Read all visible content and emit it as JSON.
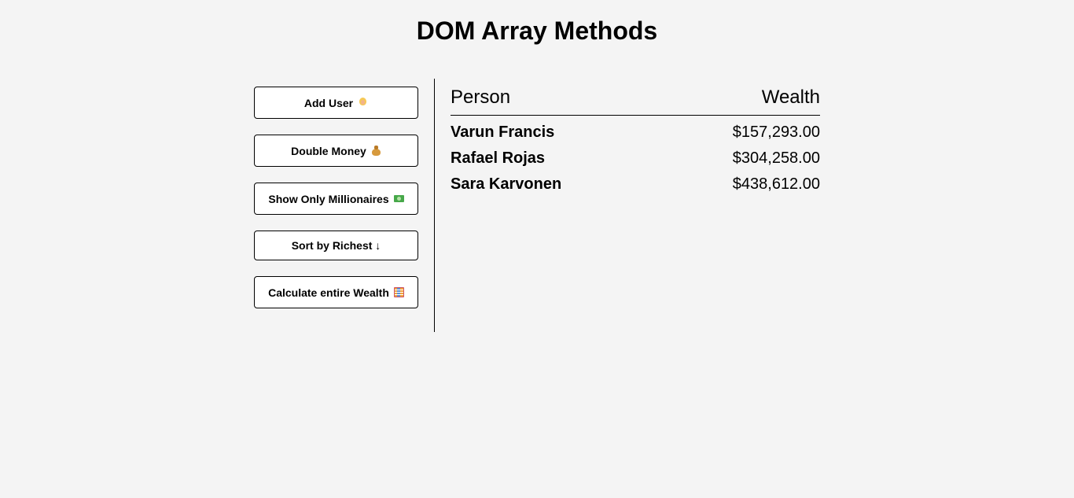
{
  "page": {
    "title": "DOM Array Methods"
  },
  "buttons": [
    {
      "label": "Add User",
      "icon": "person-emoji-icon"
    },
    {
      "label": "Double Money",
      "icon": "money-bag-emoji-icon"
    },
    {
      "label": "Show Only Millionaires",
      "icon": "dollar-bill-emoji-icon"
    },
    {
      "label": "Sort by Richest ↓",
      "icon": ""
    },
    {
      "label": "Calculate entire Wealth",
      "icon": "abacus-emoji-icon"
    }
  ],
  "table": {
    "headers": {
      "person": "Person",
      "wealth": "Wealth"
    },
    "rows": [
      {
        "name": "Varun Francis",
        "wealth": "$157,293.00"
      },
      {
        "name": "Rafael Rojas",
        "wealth": "$304,258.00"
      },
      {
        "name": "Sara Karvonen",
        "wealth": "$438,612.00"
      }
    ]
  },
  "colors": {
    "background": "#f4f4f4",
    "button_background": "#ffffff",
    "text": "#000000"
  }
}
